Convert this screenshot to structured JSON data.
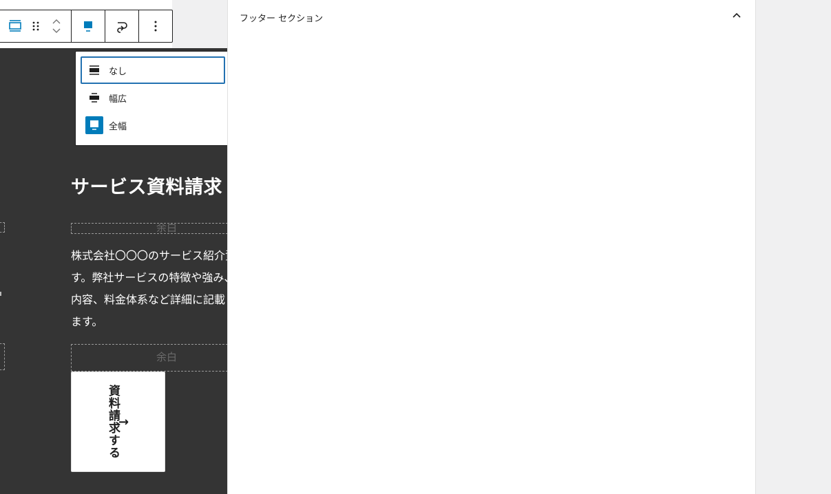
{
  "toolbar": {
    "buttons": [
      {
        "name": "block-type",
        "icon": "group-icon"
      },
      {
        "name": "drag",
        "icon": "drag-handle-icon"
      },
      {
        "name": "move-up",
        "icon": "chevron-up-icon"
      },
      {
        "name": "move-down",
        "icon": "chevron-down-icon"
      },
      {
        "name": "align",
        "icon": "align-full-icon"
      },
      {
        "name": "link",
        "icon": "link-icon"
      },
      {
        "name": "more",
        "icon": "more-vertical-icon"
      }
    ]
  },
  "align_menu": {
    "items": [
      {
        "label": "なし",
        "icon": "align-none-icon",
        "focused": true
      },
      {
        "label": "幅広",
        "icon": "align-wide-icon",
        "focused": false
      },
      {
        "label": "全幅",
        "icon": "align-full-icon",
        "active": true
      }
    ]
  },
  "content": {
    "heading": "サービス資料請求",
    "spacer_label_1": "余白",
    "spacer_label_2": "余白",
    "paragraph_lines": [
      "株式会社〇〇〇のサービス紹介資料で",
      "す。弊社サービスの特徴や強み、施策",
      "内容、料金体系など詳細に記載してい",
      "ます。"
    ],
    "cta_label": "資料請求する",
    "cta_arrow": "→"
  },
  "sidebar": {
    "panel_title": "フッター セクション",
    "toggle_icon": "chevron-up-icon"
  },
  "colors": {
    "accent": "#007cba",
    "dark_section": "#343434",
    "focus": "#2271b1"
  }
}
